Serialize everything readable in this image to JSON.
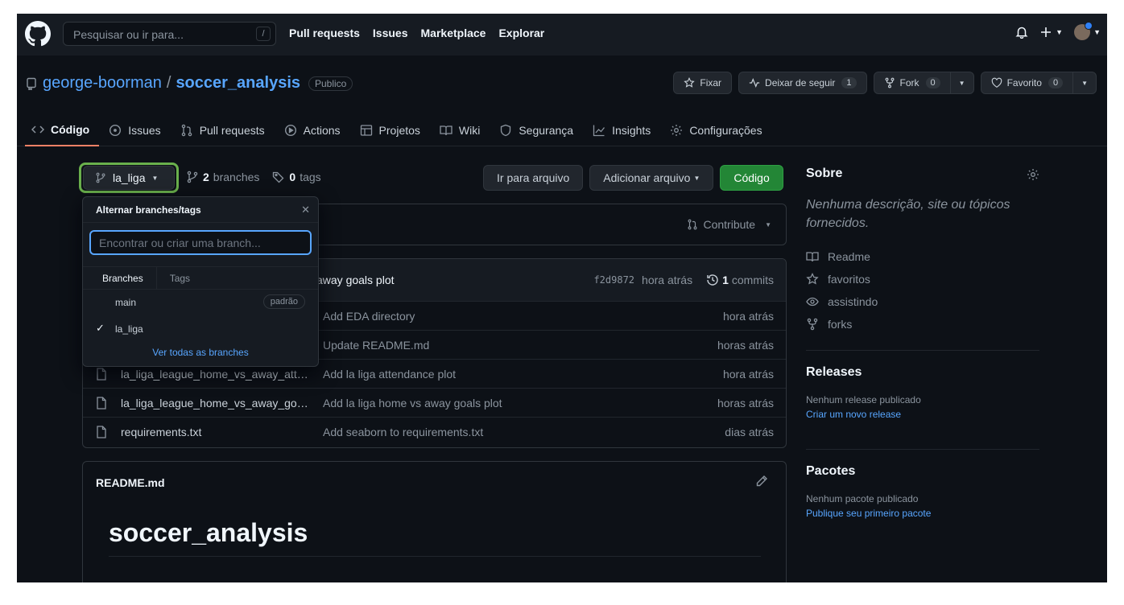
{
  "header": {
    "search_placeholder": "Pesquisar ou ir para...",
    "search_shortcut": "/",
    "nav": [
      "Pull requests",
      "Issues",
      "Marketplace",
      "Explorar"
    ]
  },
  "repo": {
    "owner": "george-boorman",
    "separator": "/",
    "name": "soccer_analysis",
    "visibility": "Publico",
    "actions": {
      "pin": "Fixar",
      "unwatch": "Deixar de seguir",
      "watch_count": "1",
      "fork": "Fork",
      "fork_count": "0",
      "star": "Favorito",
      "star_count": "0"
    },
    "tabs": [
      "Código",
      "Issues",
      "Pull requests",
      "Actions",
      "Projetos",
      "Wiki",
      "Segurança",
      "Insights",
      "Configurações"
    ]
  },
  "toolbar": {
    "branch": "la_liga",
    "branches_count": "2",
    "branches_label": "branches",
    "tags_count": "0",
    "tags_label": "tags",
    "goto_file": "Ir para arquivo",
    "add_file": "Adicionar arquivo",
    "code": "Código",
    "contribute": "Contribute"
  },
  "latest_commit": {
    "message": "away goals plot",
    "sha": "f2d9872",
    "age": "hora atrás",
    "commits_count": "1",
    "commits_label": "commits"
  },
  "files": [
    {
      "name": "",
      "message": "Add EDA directory",
      "age": "hora atrás"
    },
    {
      "name": "",
      "message": "Update README.md",
      "age": "horas atrás"
    },
    {
      "name": "la_liga_league_home_vs_away_attendance",
      "message": "Add la liga attendance plot",
      "age": "hora atrás"
    },
    {
      "name": "la_liga_league_home_vs_away_goals",
      "message": "Add la liga home vs away goals plot",
      "age": "horas atrás"
    },
    {
      "name": "requirements.txt",
      "message": "Add seaborn to requirements.txt",
      "age": "dias atrás"
    }
  ],
  "readme": {
    "filename": "README.md",
    "heading": "soccer_analysis"
  },
  "branch_dropdown": {
    "title": "Alternar branches/tags",
    "filter_placeholder": "Encontrar ou criar uma branch...",
    "tabs": [
      "Branches",
      "Tags"
    ],
    "items": [
      {
        "name": "main",
        "badge": "padrão",
        "selected": false
      },
      {
        "name": "la_liga",
        "badge": "",
        "selected": true
      }
    ],
    "view_all": "Ver todas as branches"
  },
  "sidebar": {
    "about_title": "Sobre",
    "description": "Nenhuma descrição, site ou tópicos fornecidos.",
    "links": [
      "Readme",
      "favoritos",
      "assistindo",
      "forks"
    ],
    "releases_title": "Releases",
    "releases_empty": "Nenhum release publicado",
    "releases_link": "Criar um novo release",
    "packages_title": "Pacotes",
    "packages_empty": "Nenhum pacote publicado",
    "packages_link": "Publique seu primeiro pacote"
  },
  "colors": {
    "background": "#0d1117",
    "header": "#161b22",
    "link": "#58a6ff",
    "primary_button": "#238636",
    "active_tab_underline": "#f78166",
    "highlight_ring": "#6ab04c"
  }
}
